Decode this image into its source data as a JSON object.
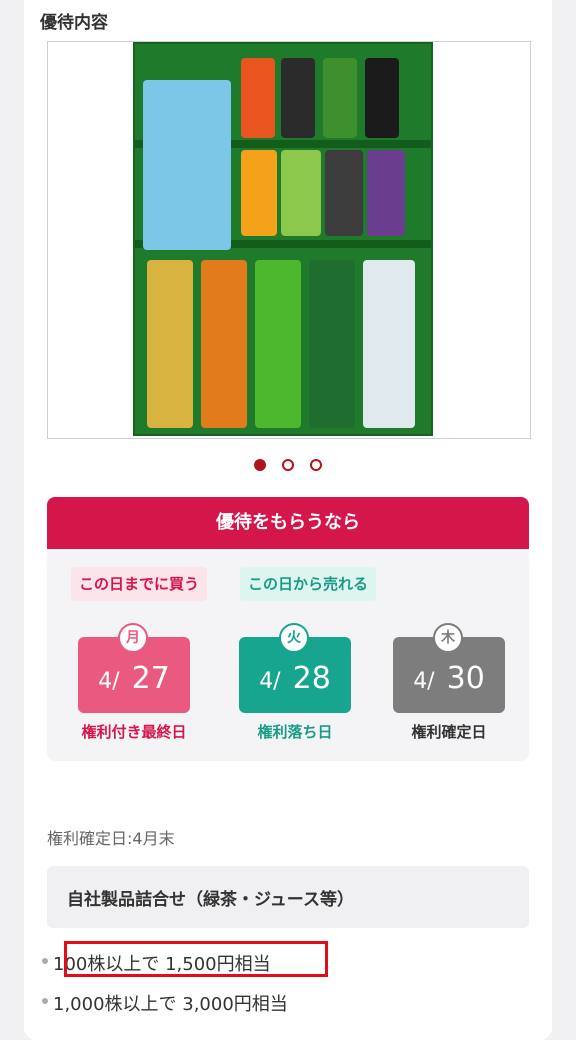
{
  "section": {
    "title": "優待内容"
  },
  "carousel": {
    "count": 3,
    "active_index": 0
  },
  "image": {
    "description_icon": "product-gift-box-image"
  },
  "benefit_panel": {
    "header": "優待をもらうなら",
    "buy_tag": "この日までに買う",
    "sell_tag": "この日から売れる",
    "dates": [
      {
        "weekday": "月",
        "month": "4/",
        "day": "27",
        "label": "権利付き最終日",
        "color": "#ea5a80"
      },
      {
        "weekday": "火",
        "month": "4/",
        "day": "28",
        "label": "権利落ち日",
        "color": "#17a58f"
      },
      {
        "weekday": "木",
        "month": "4/",
        "day": "30",
        "label": "権利確定日",
        "color": "#7d7d7d"
      }
    ]
  },
  "record_date": "権利確定日:4月末",
  "product": {
    "title": "自社製品詰合せ（緑茶・ジュース等）"
  },
  "tiers": [
    {
      "text": "100株以上で 1,500円相当",
      "highlighted": true
    },
    {
      "text": "1,000株以上で 3,000円相当",
      "highlighted": false
    }
  ]
}
